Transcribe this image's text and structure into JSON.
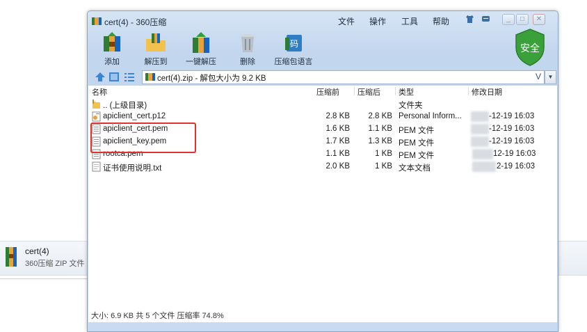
{
  "background": {
    "file_name": "cert(4)",
    "file_type": "360压缩 ZIP 文件"
  },
  "window": {
    "title": "cert(4) - 360压缩",
    "menu": [
      "文件",
      "操作",
      "工具",
      "帮助"
    ],
    "toolbar": [
      "添加",
      "解压到",
      "一键解压",
      "删除",
      "压缩包语言"
    ],
    "security_badge": "安全",
    "address": "cert(4).zip - 解包大小为 9.2 KB",
    "address_chevron": "V",
    "columns": {
      "name": "名称",
      "before": "压缩前",
      "after": "压缩后",
      "type": "类型",
      "date": "修改日期"
    },
    "files": [
      {
        "name": ".. (上级目录)",
        "before": "",
        "after": "",
        "type": "文件夹",
        "date": "",
        "icon": "folder-up-icon"
      },
      {
        "name": "apiclient_cert.p12",
        "before": "2.8 KB",
        "after": "2.8 KB",
        "type": "Personal Inform...",
        "date": "-12-19 16:03",
        "icon": "certificate-icon"
      },
      {
        "name": "apiclient_cert.pem",
        "before": "1.6 KB",
        "after": "1.1 KB",
        "type": "PEM 文件",
        "date": "-12-19 16:03",
        "icon": "document-icon"
      },
      {
        "name": "apiclient_key.pem",
        "before": "1.7 KB",
        "after": "1.3 KB",
        "type": "PEM 文件",
        "date": "-12-19 16:03",
        "icon": "document-icon"
      },
      {
        "name": "rootca.pem",
        "before": "1.1 KB",
        "after": "1 KB",
        "type": "PEM 文件",
        "date": "12-19 16:03",
        "icon": "document-icon"
      },
      {
        "name": "证书使用说明.txt",
        "before": "2.0 KB",
        "after": "1 KB",
        "type": "文本文档",
        "date": "2-19 16:03",
        "icon": "text-file-icon"
      }
    ],
    "status": "大小: 6.9 KB 共 5 个文件 压缩率 74.8%"
  }
}
